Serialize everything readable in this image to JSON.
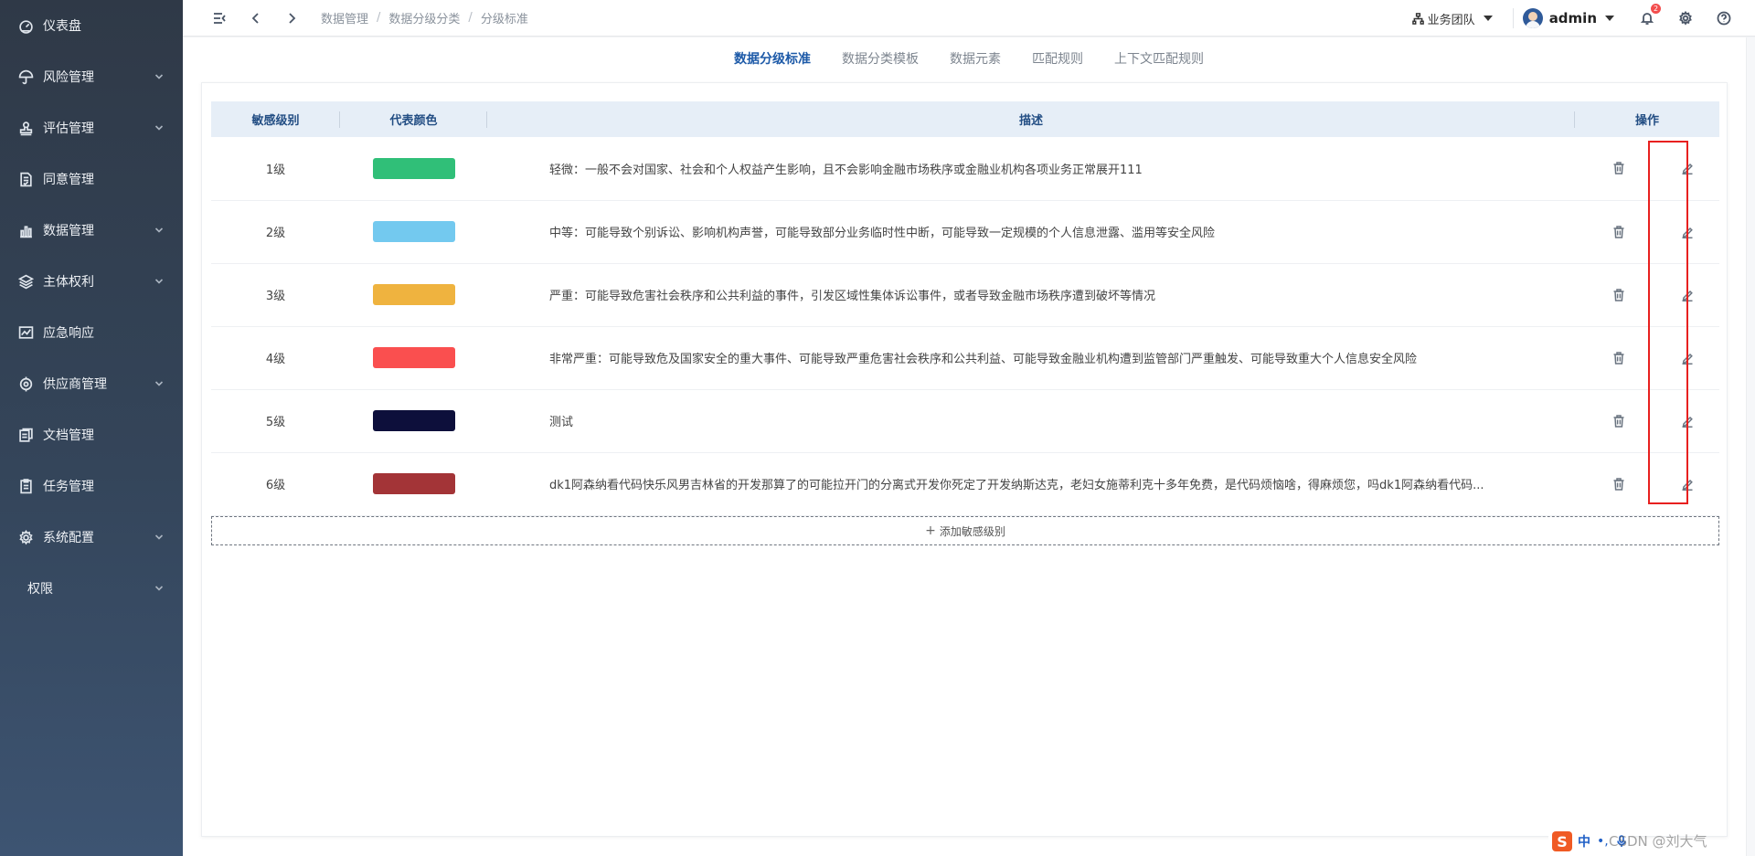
{
  "sidebar": {
    "items": [
      {
        "label": "仪表盘",
        "icon": "dashboard-icon",
        "has_children": false
      },
      {
        "label": "风险管理",
        "icon": "umbrella-icon",
        "has_children": true
      },
      {
        "label": "评估管理",
        "icon": "stamp-icon",
        "has_children": true
      },
      {
        "label": "同意管理",
        "icon": "document-check-icon",
        "has_children": false
      },
      {
        "label": "数据管理",
        "icon": "bar-chart-icon",
        "has_children": true
      },
      {
        "label": "主体权利",
        "icon": "layers-icon",
        "has_children": true
      },
      {
        "label": "应急响应",
        "icon": "alert-chart-icon",
        "has_children": false
      },
      {
        "label": "供应商管理",
        "icon": "supplier-icon",
        "has_children": true
      },
      {
        "label": "文档管理",
        "icon": "documents-icon",
        "has_children": false
      },
      {
        "label": "任务管理",
        "icon": "task-icon",
        "has_children": false
      },
      {
        "label": "系统配置",
        "icon": "settings-gear-icon",
        "has_children": true
      },
      {
        "label": "权限",
        "icon": "",
        "has_children": true
      }
    ]
  },
  "header": {
    "breadcrumb": [
      "数据管理",
      "数据分级分类",
      "分级标准"
    ],
    "breadcrumb_sep": "/",
    "team_label": "业务团队",
    "username": "admin",
    "notification_count": "2"
  },
  "tabs": [
    {
      "label": "数据分级标准",
      "active": true
    },
    {
      "label": "数据分类模板",
      "active": false
    },
    {
      "label": "数据元素",
      "active": false
    },
    {
      "label": "匹配规则",
      "active": false
    },
    {
      "label": "上下文匹配规则",
      "active": false
    }
  ],
  "table": {
    "columns": [
      "敏感级别",
      "代表颜色",
      "描述",
      "操作"
    ],
    "rows": [
      {
        "level": "1级",
        "color": "#30bf78",
        "description": "轻微：一般不会对国家、社会和个人权益产生影响，且不会影响金融市场秩序或金融业机构各项业务正常展开111"
      },
      {
        "level": "2级",
        "color": "#73c9ef",
        "description": "中等：可能导致个别诉讼、影响机构声誉，可能导致部分业务临时性中断，可能导致一定规模的个人信息泄露、滥用等安全风险"
      },
      {
        "level": "3级",
        "color": "#efb33f",
        "description": "严重：可能导致危害社会秩序和公共利益的事件，引发区域性集体诉讼事件，或者导致金融市场秩序遭到破坏等情况"
      },
      {
        "level": "4级",
        "color": "#fa4f4f",
        "description": "非常严重：可能导致危及国家安全的重大事件、可能导致严重危害社会秩序和公共利益、可能导致金融业机构遭到监管部门严重触发、可能导致重大个人信息安全风险"
      },
      {
        "level": "5级",
        "color": "#0d0f3b",
        "description": "测试"
      },
      {
        "level": "6级",
        "color": "#a33437",
        "description": "dk1阿森纳看代码快乐风男吉林省的开发那算了的可能拉开门的分离式开发你死定了开发纳斯达克，老妇女施蒂利克十多年免费，是代码烦恼啥，得麻烦您，吗dk1阿森纳看代码..."
      }
    ],
    "add_label": "添加敏感级别"
  },
  "ime": {
    "logo": "S",
    "lang": "中",
    "punct": "•,"
  },
  "watermark": "CSDN @刘大气",
  "colors": {
    "accent": "#1d5aa8",
    "highlight": "#e8201f"
  }
}
